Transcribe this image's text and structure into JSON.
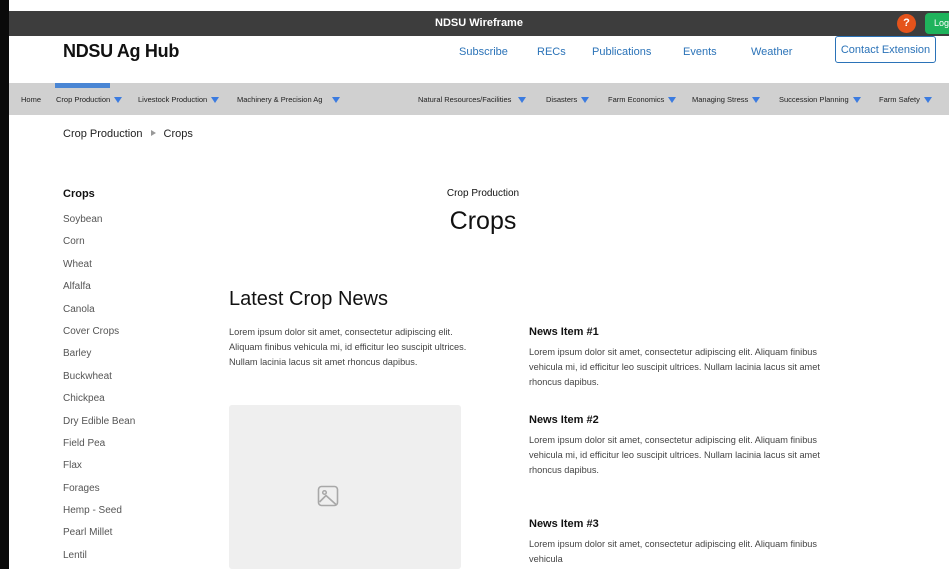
{
  "window": {
    "title": "NDSU Wireframe",
    "help_label": "?",
    "login_label": "Log"
  },
  "header": {
    "site_title": "NDSU Ag Hub",
    "nav": [
      "Subscribe",
      "RECs",
      "Publications",
      "Events",
      "Weather"
    ],
    "contact_button": "Contact Extension"
  },
  "subnav": {
    "home": "Home",
    "items": [
      "Crop Production",
      "Livestock Production",
      "Machinery & Precision Ag",
      "Natural Resources/Facilities",
      "Disasters",
      "Farm Economics",
      "Managing Stress",
      "Succession Planning",
      "Farm Safety"
    ]
  },
  "breadcrumb": {
    "parent": "Crop Production",
    "current": "Crops"
  },
  "sidebar": {
    "title": "Crops",
    "items": [
      "Soybean",
      "Corn",
      "Wheat",
      "Alfalfa",
      "Canola",
      "Cover Crops",
      "Barley",
      "Buckwheat",
      "Chickpea",
      "Dry Edible Bean",
      "Field Pea",
      "Flax",
      "Forages",
      "Hemp - Seed",
      "Pearl Millet",
      "Lentil"
    ]
  },
  "main": {
    "eyebrow": "Crop Production",
    "title": "Crops",
    "news_heading": "Latest Crop News",
    "intro": "Lorem ipsum dolor sit amet, consectetur adipiscing elit. Aliquam finibus vehicula mi, id efficitur leo suscipit ultrices. Nullam lacinia lacus sit amet rhoncus dapibus.",
    "news": [
      {
        "title": "News Item #1",
        "body": "Lorem ipsum dolor sit amet, consectetur adipiscing elit. Aliquam finibus vehicula mi, id efficitur leo suscipit ultrices. Nullam lacinia lacus sit amet rhoncus dapibus."
      },
      {
        "title": "News Item #2",
        "body": "Lorem ipsum dolor sit amet, consectetur adipiscing elit. Aliquam finibus vehicula mi, id efficitur leo suscipit ultrices. Nullam lacinia lacus sit amet rhoncus dapibus."
      },
      {
        "title": "News Item #3",
        "body": "Lorem ipsum dolor sit amet, consectetur adipiscing elit. Aliquam finibus vehicula"
      }
    ]
  },
  "colors": {
    "accent": "#2b73b8",
    "titlebar": "#3d3d3d",
    "subnav": "#d0d0d0",
    "caret": "#3b7be0",
    "help": "#e5531b",
    "login": "#1fb35c"
  },
  "icons": {
    "image_placeholder": "image-icon",
    "dropdown": "chevron-down-icon",
    "breadcrumb_separator": "triangle-right-icon"
  }
}
